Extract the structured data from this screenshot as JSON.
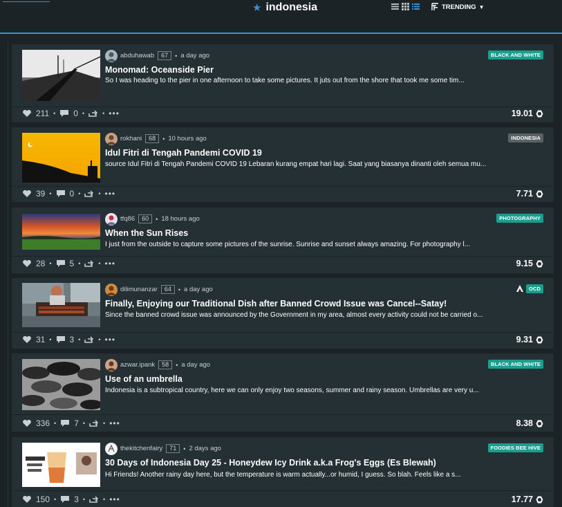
{
  "header": {
    "community_title": "indonesia",
    "sort_label": "TRENDING"
  },
  "posts": [
    {
      "author": "abduhawab",
      "reputation": "67",
      "time": "a day ago",
      "title": "Monomad: Oceanside Pier",
      "excerpt": "So I was heading to the pier in one afternoon to take some pictures. It juts out from the shore that took me some tim...",
      "tag": "BLACK AND WHITE",
      "votes": "211",
      "comments": "0",
      "payout": "19.01"
    },
    {
      "author": "rokhani",
      "reputation": "68",
      "time": "10 hours ago",
      "title": "Idul Fitri di Tengah Pandemi COVID 19",
      "excerpt": "source Idul Fitri di Tengah Pandemi COVID 19 Lebaran kurang empat hari lagi. Saat yang biasanya dinanti oleh semua mu...",
      "tag": "INDONESIA",
      "votes": "39",
      "comments": "0",
      "payout": "7.71"
    },
    {
      "author": "tfq86",
      "reputation": "60",
      "time": "18 hours ago",
      "title": "When the Sun Rises",
      "excerpt": "I just from the outside to capture some pictures of the sunrise. Sunrise and sunset always amazing. For photography l...",
      "tag": "PHOTOGRAPHY",
      "votes": "28",
      "comments": "5",
      "payout": "9.15"
    },
    {
      "author": "dilimunanzar",
      "reputation": "64",
      "time": "a day ago",
      "title": "Finally, Enjoying our Traditional Dish after Banned Crowd Issue was Cancel--Satay!",
      "excerpt": "Since the banned crowd issue was announced by the Government in my area, almost every activity could not be carried o...",
      "tag": "OCD",
      "votes": "31",
      "comments": "3",
      "payout": "9.31"
    },
    {
      "author": "azwar.ipank",
      "reputation": "58",
      "time": "a day ago",
      "title": "Use of an umbrella",
      "excerpt": "Indonesia is a subtropical country, here we can only enjoy two seasons, summer and rainy season. Umbrellas are very u...",
      "tag": "BLACK AND WHITE",
      "votes": "336",
      "comments": "7",
      "payout": "8.38"
    },
    {
      "author": "thekitchenfairy",
      "reputation": "71",
      "time": "2 days ago",
      "title": "30 Days of Indonesia Day 25 - Honeydew Icy Drink a.k.a Frog's Eggs (Es Blewah)",
      "excerpt": "Hi Friends! Another rainy day here, but the temperature is warm actually...or humid, I guess. So blah. Feels like a s...",
      "tag": "FOODIES BEE HIVE",
      "votes": "150",
      "comments": "3",
      "payout": "17.77"
    }
  ],
  "colors": {
    "accent": "#3a8fd6",
    "tag_green": "#1b9e8e",
    "tag_grey": "#5a6266",
    "card_bg": "#253035",
    "page_bg": "#1b2327"
  },
  "icons": {
    "star": "star-icon",
    "list_view": "list-view-icon",
    "grid_view": "grid-view-icon",
    "compact_view": "compact-view-icon",
    "trending": "trending-icon",
    "heart": "heart-icon",
    "comment": "comment-icon",
    "reblog": "reblog-icon",
    "more": "more-icon",
    "token": "hive-token-icon"
  }
}
